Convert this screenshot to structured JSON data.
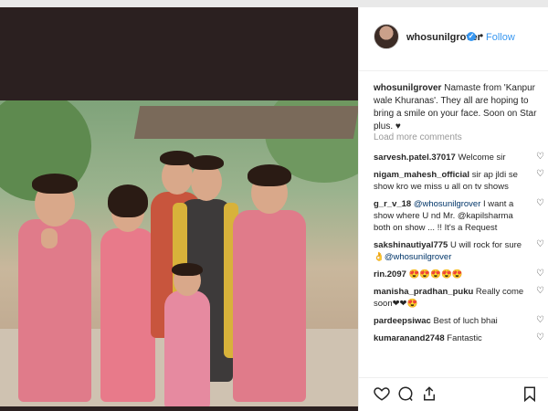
{
  "post": {
    "username": "whosunilgrover",
    "follow_label": "Follow",
    "dot": "•",
    "verified_mark": "✓",
    "caption_user": "whosunilgrover",
    "caption_text": "Namaste from 'Kanpur wale Khuranas'. They all are hoping to bring a smile on your face. Soon on Star plus. ♥",
    "load_more": "Load more comments"
  },
  "comments": [
    {
      "user": "sarvesh.patel.37017",
      "text": "Welcome sir"
    },
    {
      "user": "nigam_mahesh_official",
      "text": "sir ap jldi se show kro we miss u all on tv shows"
    },
    {
      "user": "g_r_v_18",
      "mention": "@whosunilgrover",
      "text": "I want a show where U nd Mr. @kapilsharma both on show ... !! It's a Request"
    },
    {
      "user": "sakshinautiyal775",
      "text": "U will rock for sure",
      "text2": "👌@whosunilgrover"
    },
    {
      "user": "rin.2097",
      "text": "😍😍😍😍😍"
    },
    {
      "user": "manisha_pradhan_puku",
      "text": "Really come soon❤❤😍"
    },
    {
      "user": "pardeepsiwac",
      "text": "Best of luch bhai"
    },
    {
      "user": "kumaranand2748",
      "text": "Fantastic"
    }
  ],
  "icons": {
    "like": "heart-icon",
    "comment": "comment-icon",
    "share": "share-icon",
    "save": "bookmark-icon"
  },
  "colors": {
    "link": "#3897f0",
    "text": "#262626",
    "muted": "#999999",
    "photo_backdrop": "#2b2020"
  }
}
